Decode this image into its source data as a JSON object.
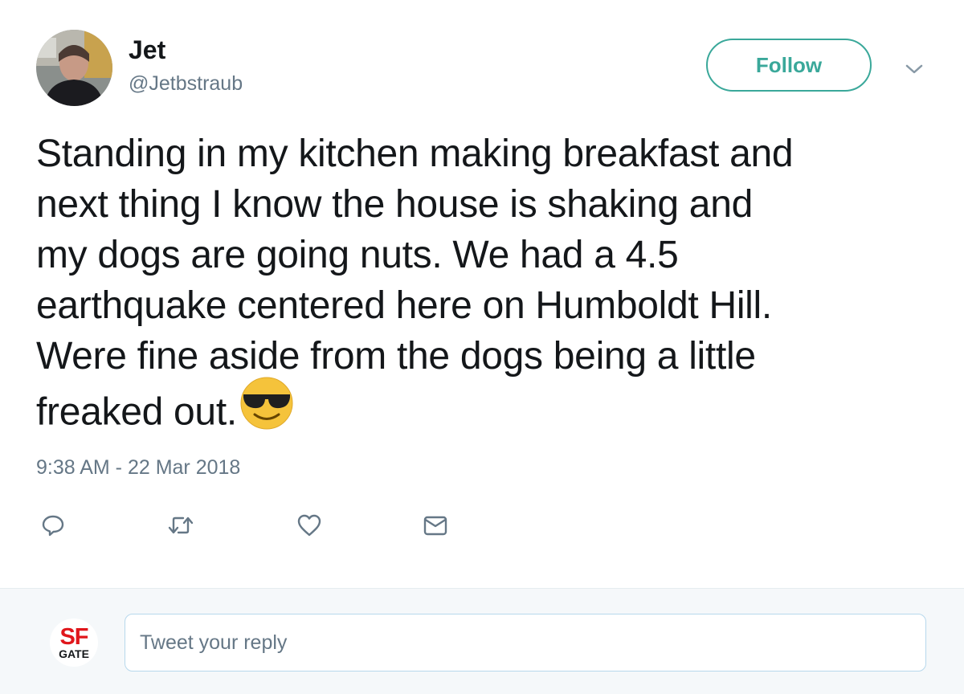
{
  "author": {
    "display_name": "Jet",
    "handle": "@Jetbstraub"
  },
  "follow_button": {
    "label": "Follow"
  },
  "tweet": {
    "lines": [
      "Standing in my kitchen making breakfast and",
      "next thing I know the house is shaking and",
      "my dogs are going nuts. We had a 4.5",
      "earthquake centered here on Humboldt Hill.",
      "Were fine aside from the dogs being a little",
      "freaked out."
    ],
    "emoji": "smiling-face-with-sunglasses",
    "timestamp": "9:38 AM - 22 Mar 2018"
  },
  "actions": {
    "reply_icon": "speech-bubble-icon",
    "retweet_icon": "retweet-icon",
    "like_icon": "heart-icon",
    "dm_icon": "envelope-icon"
  },
  "reply_bar": {
    "logo_top": "SF",
    "logo_bottom": "GATE",
    "placeholder": "Tweet your reply"
  },
  "colors": {
    "follow_accent": "#3aa89a",
    "secondary_text": "#657786",
    "reply_bar_bg": "#f5f8fa",
    "logo_red": "#e0161b"
  }
}
